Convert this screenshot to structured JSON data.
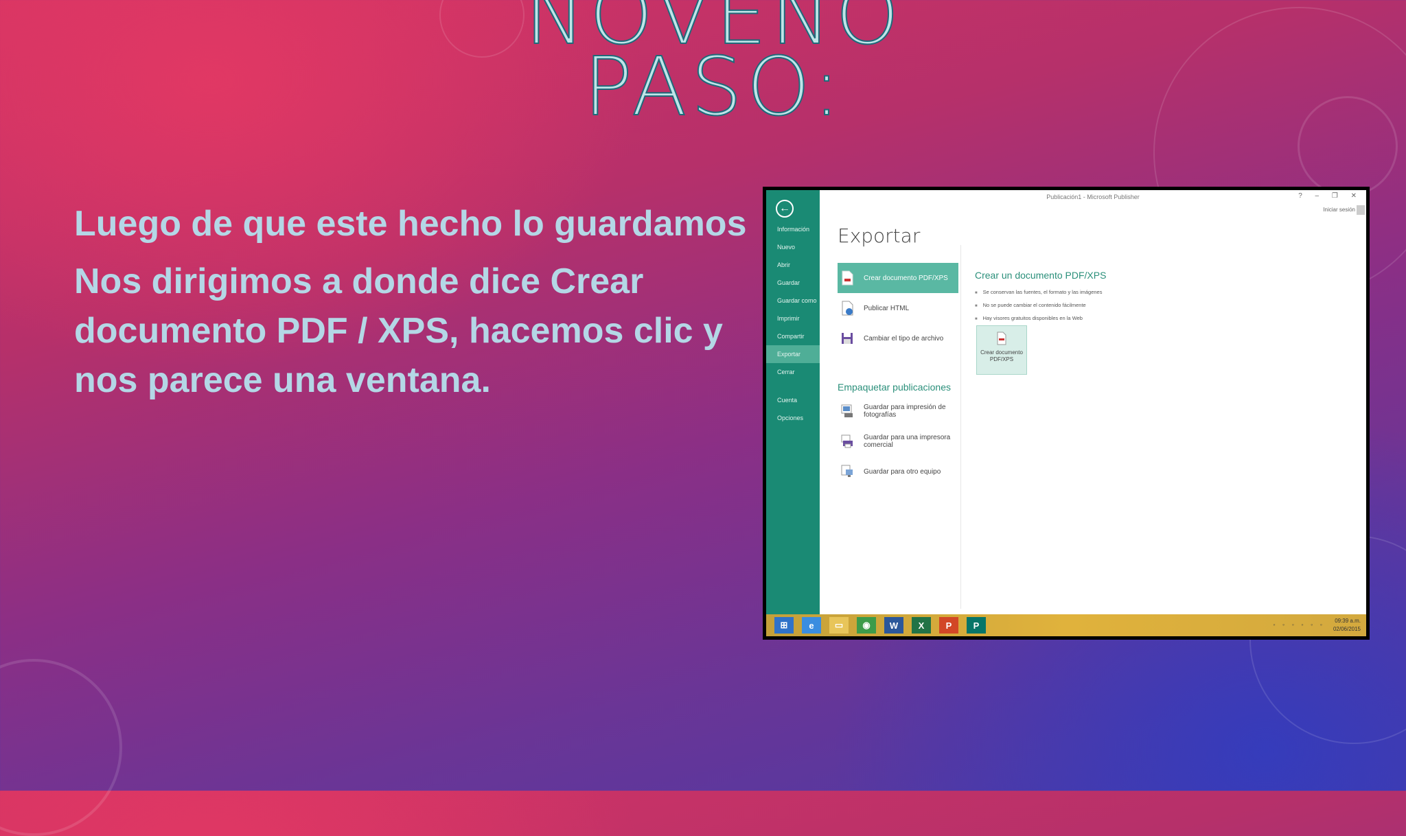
{
  "slide": {
    "title_lines": [
      "NOVENO",
      "PASO:"
    ],
    "paragraphs": [
      "Luego de que este hecho lo guardamos",
      "Nos dirigimos a donde dice Crear documento PDF / XPS, hacemos clic y nos parece una ventana."
    ]
  },
  "app": {
    "window_title": "Publicación1 - Microsoft Publisher",
    "window_controls": "? – ❐ ✕",
    "signin": "Iniciar sesión",
    "back_icon": "arrow-left-icon",
    "sidebar_items": [
      {
        "label": "Información",
        "active": false
      },
      {
        "label": "Nuevo",
        "active": false
      },
      {
        "label": "Abrir",
        "active": false
      },
      {
        "label": "Guardar",
        "active": false
      },
      {
        "label": "Guardar como",
        "active": false
      },
      {
        "label": "Imprimir",
        "active": false
      },
      {
        "label": "Compartir",
        "active": false
      },
      {
        "label": "Exportar",
        "active": true
      },
      {
        "label": "Cerrar",
        "active": false
      },
      {
        "label": "Cuenta",
        "active": false
      },
      {
        "label": "Opciones",
        "active": false
      }
    ],
    "heading": "Exportar",
    "export_options": [
      {
        "label": "Crear documento PDF/XPS",
        "icon": "pdf-document-icon",
        "active": true
      },
      {
        "label": "Publicar HTML",
        "icon": "html-publish-icon",
        "active": false
      },
      {
        "label": "Cambiar el tipo de archivo",
        "icon": "save-disk-icon",
        "active": false
      }
    ],
    "package_section_label": "Empaquetar publicaciones",
    "package_options": [
      {
        "label": "Guardar para impresión de fotografías",
        "icon": "photo-print-icon"
      },
      {
        "label": "Guardar para una impresora comercial",
        "icon": "commercial-printer-icon"
      },
      {
        "label": "Guardar para otro equipo",
        "icon": "computer-icon"
      }
    ],
    "detail_title": "Crear un documento PDF/XPS",
    "detail_bullets": [
      "Se conservan las fuentes, el formato y las imágenes",
      "No se puede cambiar el contenido fácilmente",
      "Hay visores gratuitos disponibles en la Web"
    ],
    "big_button_label": "Crear documento PDF/XPS",
    "taskbar_icons": [
      "windows-start-icon",
      "internet-explorer-icon",
      "file-explorer-icon",
      "chrome-icon",
      "word-icon",
      "excel-icon",
      "powerpoint-icon",
      "publisher-icon"
    ],
    "taskbar_glyphs": [
      "⊞",
      "e",
      "▭",
      "◉",
      "W",
      "X",
      "P",
      "P"
    ],
    "taskbar_colors": [
      "#2f72c9",
      "#3a8de0",
      "#e8c55a",
      "#3d9b4a",
      "#2b579a",
      "#217346",
      "#d24726",
      "#077568"
    ],
    "tray_time": "09:39 a.m.",
    "tray_date": "02/06/2015"
  }
}
